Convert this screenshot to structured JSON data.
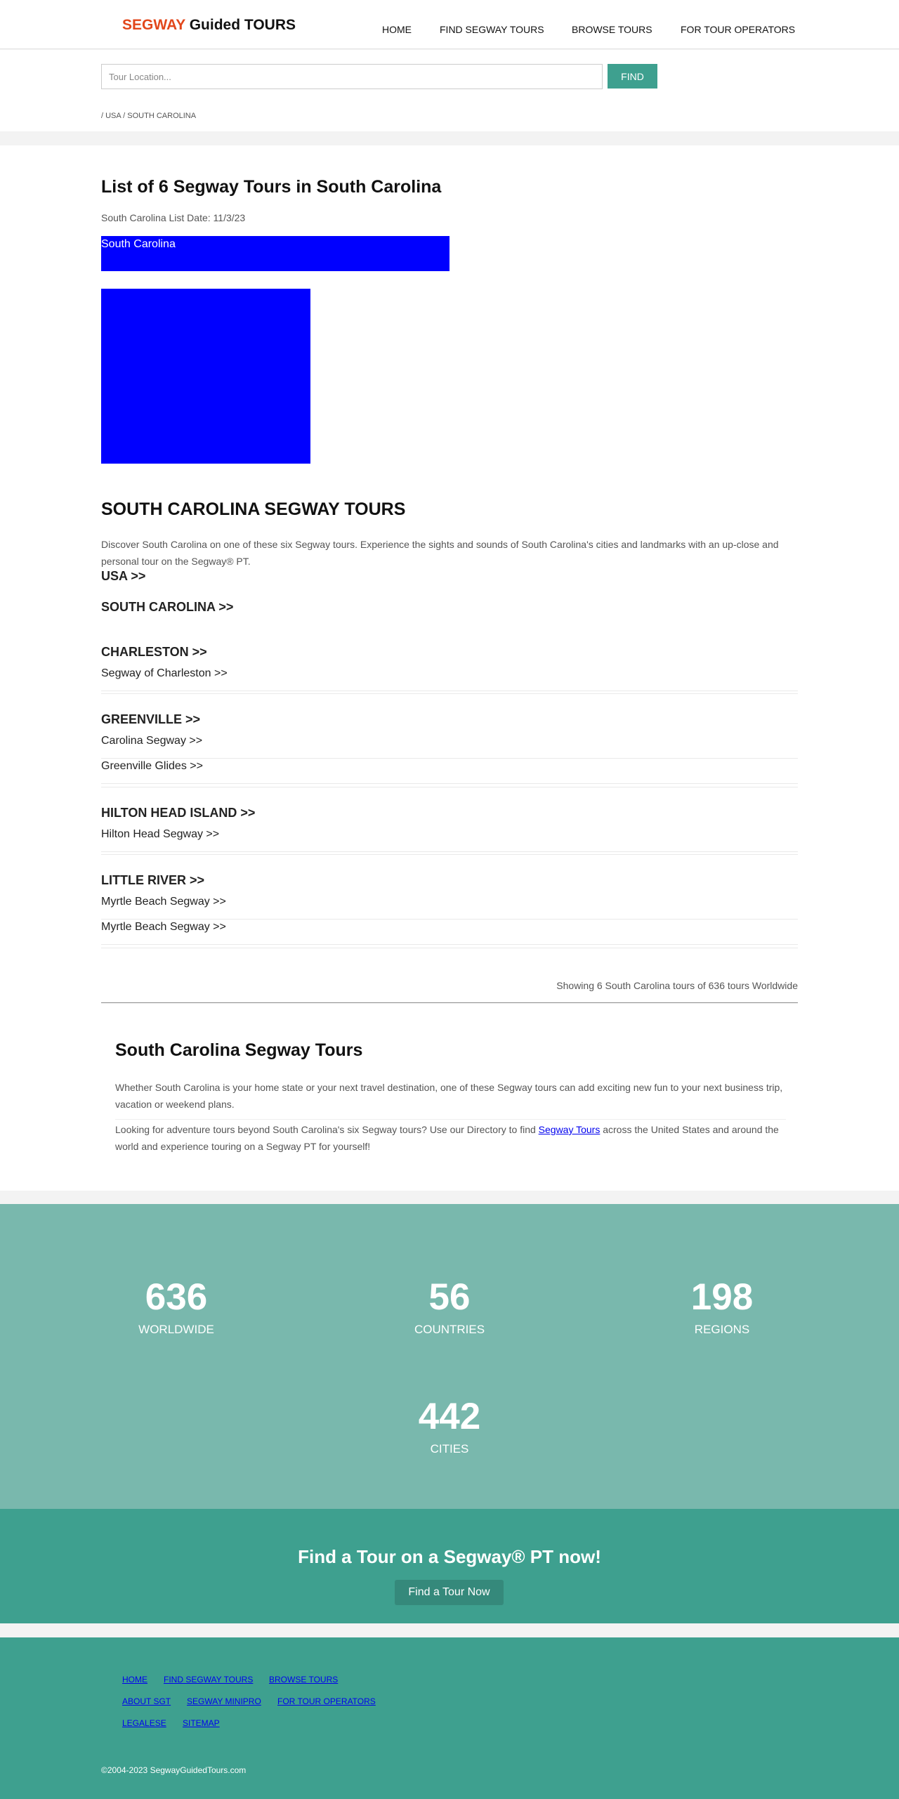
{
  "header": {
    "logo_accent": "SEGWAY",
    "logo_rest": " Guided TOURS",
    "nav": [
      "HOME",
      "FIND SEGWAY TOURS",
      "BROWSE TOURS",
      "FOR TOUR OPERATORS"
    ]
  },
  "search": {
    "placeholder": "Tour Location...",
    "button_label": "FIND"
  },
  "breadcrumb": "/ USA / SOUTH CAROLINA",
  "main": {
    "title": "List of 6 Segway Tours in South Carolina",
    "list_date": "South Carolina List Date: 11/3/23",
    "map_label": "South Carolina",
    "section_title": "SOUTH CAROLINA SEGWAY TOURS",
    "intro": "Discover South Carolina on one of these six Segway tours. Experience the sights and sounds of South Carolina's cities and landmarks with an up-close and personal tour on the Segway® PT.",
    "crumb_usa": "USA >>",
    "crumb_state": "SOUTH CAROLINA >>",
    "cities": [
      {
        "name": "CHARLESTON >>",
        "tours": [
          "Segway of Charleston >>"
        ]
      },
      {
        "name": "GREENVILLE >>",
        "tours": [
          "Carolina Segway >>",
          "Greenville Glides >>"
        ]
      },
      {
        "name": "HILTON HEAD ISLAND >>",
        "tours": [
          "Hilton Head Segway >>"
        ]
      },
      {
        "name": "LITTLE RIVER >>",
        "tours": [
          "Myrtle Beach Segway >>",
          "Myrtle Beach Segway >>"
        ]
      }
    ],
    "showing": "Showing 6 South Carolina tours of 636 tours Worldwide",
    "about_title": "South Carolina Segway Tours",
    "about_p1": "Whether South Carolina is your home state or your next travel destination, one of these Segway tours can add exciting new fun to your next business trip, vacation or weekend plans.",
    "about_p2_before": "Looking for adventure tours beyond South Carolina's six Segway tours? Use our Directory to find ",
    "about_p2_link": "Segway Tours",
    "about_p2_after": " across the United States and around the world and experience touring on a Segway PT for yourself!"
  },
  "stats": [
    {
      "value": "636",
      "label": "WORLDWIDE"
    },
    {
      "value": "56",
      "label": "COUNTRIES"
    },
    {
      "value": "198",
      "label": "REGIONS"
    },
    {
      "value": "442",
      "label": "CITIES"
    }
  ],
  "cta": {
    "title": "Find a Tour on a Segway® PT now!",
    "button": "Find a Tour Now"
  },
  "footer": {
    "row1": [
      "HOME",
      "FIND SEGWAY TOURS",
      "BROWSE TOURS"
    ],
    "row2": [
      "ABOUT SGT",
      "SEGWAY MINIPRO",
      "FOR TOUR OPERATORS"
    ],
    "row3": [
      "LEGALESE",
      "SITEMAP"
    ],
    "copyright": "©2004-2023 SegwayGuidedTours.com"
  },
  "colors": {
    "brand_accent": "#e2471b",
    "teal": "#3ea08f",
    "teal_light": "#79b8ad",
    "map_blue": "#0000ff"
  }
}
